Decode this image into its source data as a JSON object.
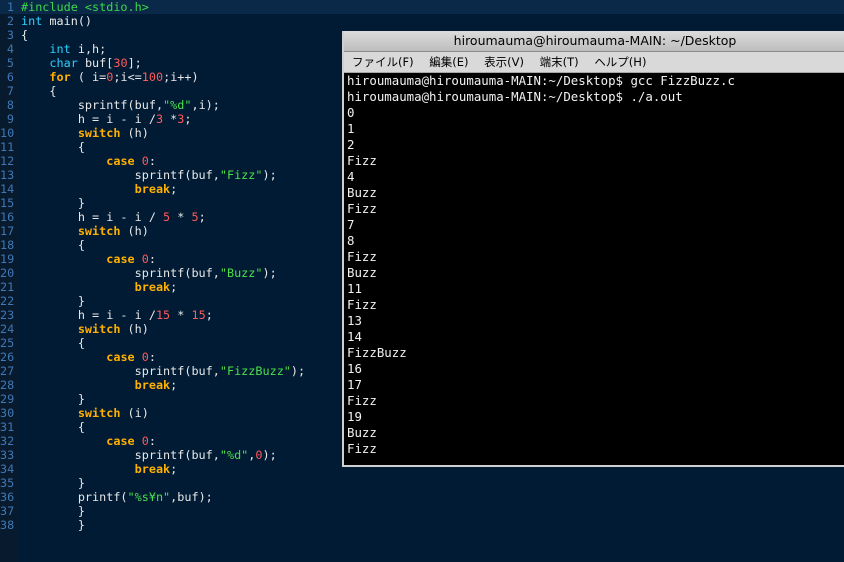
{
  "editor": {
    "lines": [
      {
        "n": "1",
        "t": "#include <stdio.h>"
      },
      {
        "n": "2",
        "t": "int main()"
      },
      {
        "n": "3",
        "t": "{"
      },
      {
        "n": "4",
        "t": "    int i,h;"
      },
      {
        "n": "5",
        "t": "    char buf[30];"
      },
      {
        "n": "6",
        "t": "    for ( i=0;i<=100;i++)"
      },
      {
        "n": "7",
        "t": "    {"
      },
      {
        "n": "8",
        "t": "        sprintf(buf,\"%d\",i);"
      },
      {
        "n": "9",
        "t": "        h = i - i /3 *3;"
      },
      {
        "n": "10",
        "t": "        switch (h)"
      },
      {
        "n": "11",
        "t": "        {"
      },
      {
        "n": "12",
        "t": "            case 0:"
      },
      {
        "n": "13",
        "t": "                sprintf(buf,\"Fizz\");"
      },
      {
        "n": "14",
        "t": "                break;"
      },
      {
        "n": "15",
        "t": "        }"
      },
      {
        "n": "16",
        "t": "        h = i - i / 5 * 5;"
      },
      {
        "n": "17",
        "t": "        switch (h)"
      },
      {
        "n": "18",
        "t": "        {"
      },
      {
        "n": "19",
        "t": "            case 0:"
      },
      {
        "n": "20",
        "t": "                sprintf(buf,\"Buzz\");"
      },
      {
        "n": "21",
        "t": "                break;"
      },
      {
        "n": "22",
        "t": "        }"
      },
      {
        "n": "23",
        "t": "        h = i - i /15 * 15;"
      },
      {
        "n": "24",
        "t": "        switch (h)"
      },
      {
        "n": "25",
        "t": "        {"
      },
      {
        "n": "26",
        "t": "            case 0:"
      },
      {
        "n": "27",
        "t": "                sprintf(buf,\"FizzBuzz\");"
      },
      {
        "n": "28",
        "t": "                break;"
      },
      {
        "n": "29",
        "t": "        }"
      },
      {
        "n": "30",
        "t": "        switch (i)"
      },
      {
        "n": "31",
        "t": "        {"
      },
      {
        "n": "32",
        "t": "            case 0:"
      },
      {
        "n": "33",
        "t": "                sprintf(buf,\"%d\",0);"
      },
      {
        "n": "34",
        "t": "                break;"
      },
      {
        "n": "35",
        "t": "        }"
      },
      {
        "n": "36",
        "t": "        printf(\"%s¥n\",buf);"
      },
      {
        "n": "37",
        "t": "        }"
      },
      {
        "n": "38",
        "t": "        }"
      }
    ]
  },
  "terminal": {
    "title": "hiroumauma@hiroumauma-MAIN: ~/Desktop",
    "menu": [
      "ファイル(F)",
      "編集(E)",
      "表示(V)",
      "端末(T)",
      "ヘルプ(H)"
    ],
    "output": [
      "hiroumauma@hiroumauma-MAIN:~/Desktop$ gcc FizzBuzz.c",
      "hiroumauma@hiroumauma-MAIN:~/Desktop$ ./a.out",
      "0",
      "1",
      "2",
      "Fizz",
      "4",
      "Buzz",
      "Fizz",
      "7",
      "8",
      "Fizz",
      "Buzz",
      "11",
      "Fizz",
      "13",
      "14",
      "FizzBuzz",
      "16",
      "17",
      "Fizz",
      "19",
      "Buzz",
      "Fizz"
    ]
  },
  "colors": {
    "editor_bg": "#001b33",
    "keyword": "#2ad1ff",
    "control_keyword": "#ffb000",
    "number": "#ff5b5b",
    "string": "#4be04b"
  }
}
